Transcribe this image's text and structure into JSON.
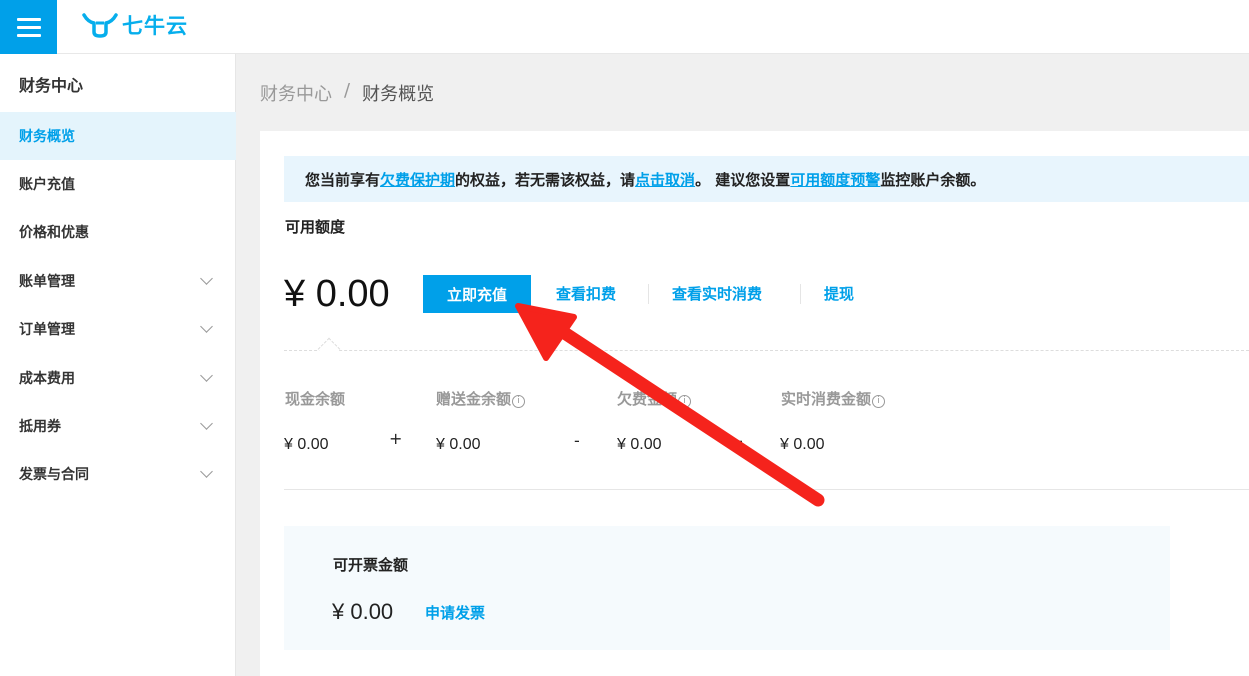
{
  "brand": {
    "name": "七牛云"
  },
  "sidebar": {
    "header": "财务中心",
    "items": [
      {
        "label": "财务概览",
        "active": true,
        "expandable": false
      },
      {
        "label": "账户充值",
        "active": false,
        "expandable": false
      },
      {
        "label": "价格和优惠",
        "active": false,
        "expandable": false
      },
      {
        "label": "账单管理",
        "active": false,
        "expandable": true
      },
      {
        "label": "订单管理",
        "active": false,
        "expandable": true
      },
      {
        "label": "成本费用",
        "active": false,
        "expandable": true
      },
      {
        "label": "抵用券",
        "active": false,
        "expandable": true
      },
      {
        "label": "发票与合同",
        "active": false,
        "expandable": true
      }
    ]
  },
  "breadcrumb": {
    "root": "财务中心",
    "separator": "/",
    "current": "财务概览"
  },
  "notice": {
    "part1": "您当前享有",
    "link1": "欠费保护期",
    "part2": "的权益，若无需该权益，请",
    "link2": "点击取消",
    "part3": "。 建议您设置",
    "link3": "可用额度预警",
    "part4": "监控账户余额。"
  },
  "available": {
    "label": "可用额度",
    "amount": "¥ 0.00",
    "recharge_button": "立即充值",
    "actions": [
      "查看扣费",
      "查看实时消费",
      "提现"
    ]
  },
  "balances": {
    "items": [
      {
        "label": "现金余额",
        "value": "¥ 0.00",
        "info": false
      },
      {
        "label": "赠送金余额",
        "value": "¥ 0.00",
        "info": true
      },
      {
        "label": "欠费金额",
        "value": "¥ 0.00",
        "info": true
      },
      {
        "label": "实时消费金额",
        "value": "¥ 0.00",
        "info": true
      }
    ],
    "operators": [
      "+",
      "-",
      "-"
    ]
  },
  "invoice": {
    "title": "可开票金额",
    "amount": "¥ 0.00",
    "link": "申请发票"
  },
  "colors": {
    "accent": "#00a0e9",
    "annotation_arrow": "#f5231c"
  }
}
